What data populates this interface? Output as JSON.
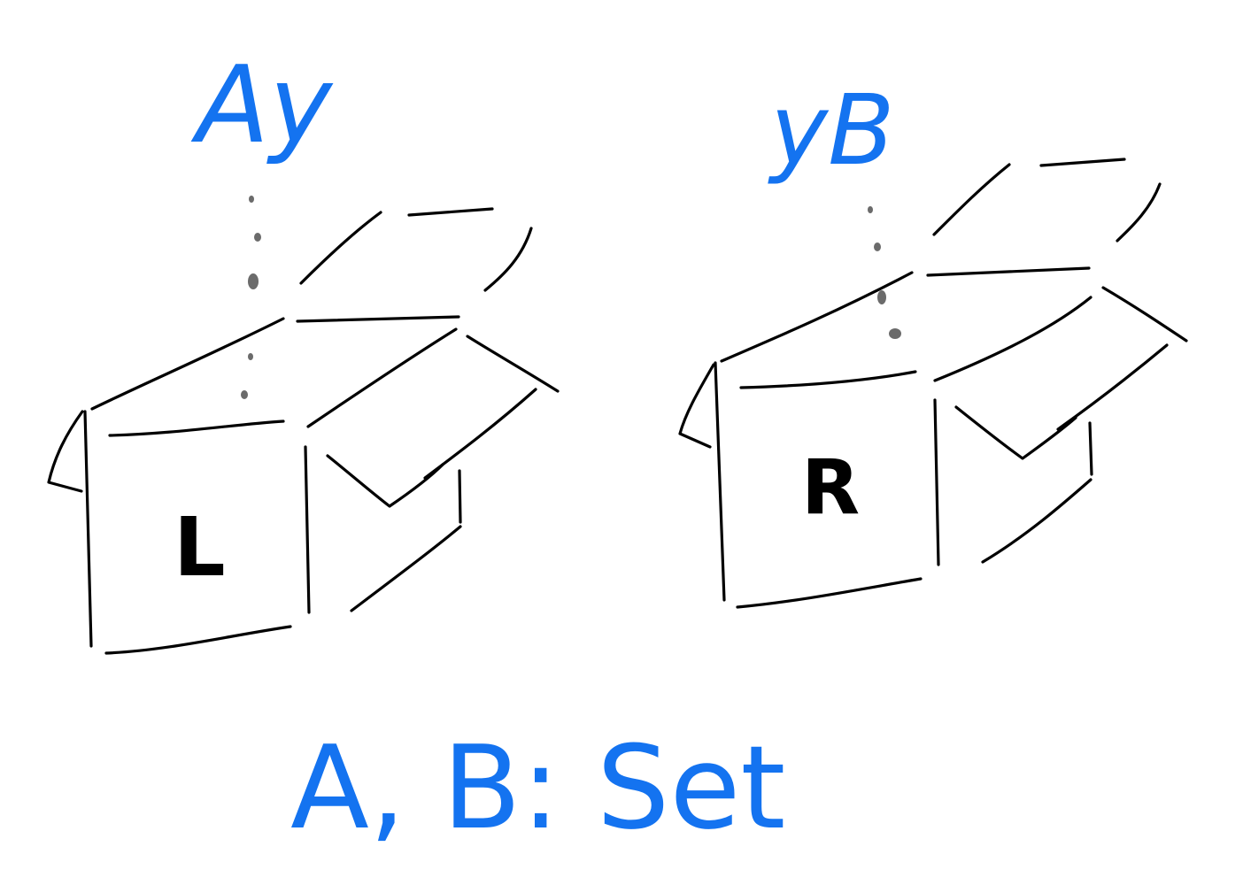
{
  "labels": {
    "left_box": "L",
    "right_box": "R",
    "left_element": "Ay",
    "right_element": "yB",
    "caption": "A, B: Set"
  },
  "colors": {
    "ink": "#000000",
    "accent": "#1473f0",
    "dotted": "#6b6b6b"
  }
}
